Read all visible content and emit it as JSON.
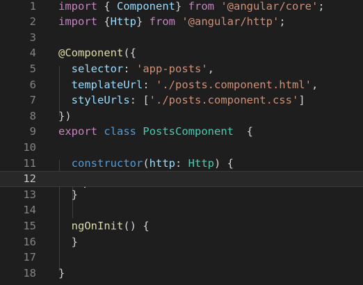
{
  "editor": {
    "current_line": "12",
    "lines": [
      {
        "num": "1",
        "tokens": [
          {
            "t": "import",
            "c": "kw"
          },
          {
            "t": " { ",
            "c": "punc"
          },
          {
            "t": "Component",
            "c": "var"
          },
          {
            "t": "} ",
            "c": "punc"
          },
          {
            "t": "from",
            "c": "kw"
          },
          {
            "t": " ",
            "c": "punc"
          },
          {
            "t": "'@angular/core'",
            "c": "str"
          },
          {
            "t": ";",
            "c": "punc"
          }
        ]
      },
      {
        "num": "2",
        "tokens": [
          {
            "t": "import",
            "c": "kw"
          },
          {
            "t": " {",
            "c": "punc"
          },
          {
            "t": "Http",
            "c": "var"
          },
          {
            "t": "} ",
            "c": "punc"
          },
          {
            "t": "from",
            "c": "kw"
          },
          {
            "t": " ",
            "c": "punc"
          },
          {
            "t": "'@angular/http'",
            "c": "str"
          },
          {
            "t": ";",
            "c": "punc"
          }
        ]
      },
      {
        "num": "3",
        "tokens": []
      },
      {
        "num": "4",
        "tokens": [
          {
            "t": "@Component",
            "c": "dec"
          },
          {
            "t": "({",
            "c": "punc"
          }
        ]
      },
      {
        "num": "5",
        "tokens": [
          {
            "t": "  ",
            "c": "punc"
          },
          {
            "t": "selector",
            "c": "var"
          },
          {
            "t": ": ",
            "c": "punc"
          },
          {
            "t": "'app-posts'",
            "c": "str"
          },
          {
            "t": ",",
            "c": "punc"
          }
        ]
      },
      {
        "num": "6",
        "tokens": [
          {
            "t": "  ",
            "c": "punc"
          },
          {
            "t": "templateUrl",
            "c": "var"
          },
          {
            "t": ": ",
            "c": "punc"
          },
          {
            "t": "'./posts.component.html'",
            "c": "str"
          },
          {
            "t": ",",
            "c": "punc"
          }
        ]
      },
      {
        "num": "7",
        "tokens": [
          {
            "t": "  ",
            "c": "punc"
          },
          {
            "t": "styleUrls",
            "c": "var"
          },
          {
            "t": ": [",
            "c": "punc"
          },
          {
            "t": "'./posts.component.css'",
            "c": "str"
          },
          {
            "t": "]",
            "c": "punc"
          }
        ]
      },
      {
        "num": "8",
        "tokens": [
          {
            "t": "})",
            "c": "punc"
          }
        ]
      },
      {
        "num": "9",
        "tokens": [
          {
            "t": "export",
            "c": "kw"
          },
          {
            "t": " ",
            "c": "punc"
          },
          {
            "t": "class",
            "c": "kw2"
          },
          {
            "t": " ",
            "c": "punc"
          },
          {
            "t": "PostsComponent",
            "c": "cls"
          },
          {
            "t": "  {",
            "c": "punc"
          }
        ]
      },
      {
        "num": "10",
        "tokens": []
      },
      {
        "num": "11",
        "tokens": [
          {
            "t": "  ",
            "c": "punc"
          },
          {
            "t": "constructor",
            "c": "kw2"
          },
          {
            "t": "(",
            "c": "punc"
          },
          {
            "t": "http",
            "c": "var"
          },
          {
            "t": ": ",
            "c": "punc"
          },
          {
            "t": "Http",
            "c": "cls"
          },
          {
            "t": ") {",
            "c": "punc"
          }
        ]
      },
      {
        "num": "12",
        "tokens": []
      },
      {
        "num": "13",
        "tokens": [
          {
            "t": "  }",
            "c": "punc"
          }
        ]
      },
      {
        "num": "14",
        "tokens": []
      },
      {
        "num": "15",
        "tokens": [
          {
            "t": "  ",
            "c": "punc"
          },
          {
            "t": "ngOnInit",
            "c": "fn"
          },
          {
            "t": "() {",
            "c": "punc"
          }
        ]
      },
      {
        "num": "16",
        "tokens": [
          {
            "t": "  }",
            "c": "punc"
          }
        ]
      },
      {
        "num": "17",
        "tokens": []
      },
      {
        "num": "18",
        "tokens": [
          {
            "t": "}",
            "c": "punc"
          }
        ]
      }
    ]
  },
  "colors": {
    "background": "#1e1e1e",
    "keyword": "#c586c0",
    "storage": "#569cd6",
    "type": "#4ec9b0",
    "variable": "#9cdcfe",
    "function": "#dcdcaa",
    "string": "#ce9178"
  }
}
